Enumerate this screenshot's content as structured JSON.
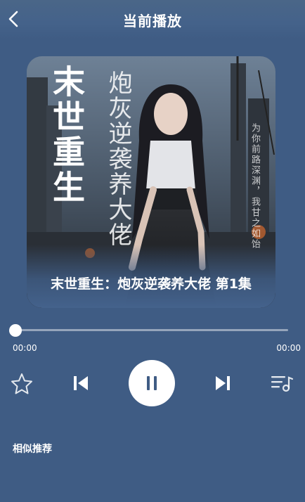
{
  "header": {
    "title": "当前播放"
  },
  "cover": {
    "big_title": "末世重生",
    "subtitle": "炮灰逆袭养大佬",
    "side_text": "为你前路深渊，我甘之如饴",
    "caption": "末世重生：炮灰逆袭养大佬 第1集"
  },
  "player": {
    "current_time": "00:00",
    "total_time": "00:00",
    "progress": 0,
    "state": "playing"
  },
  "sections": {
    "similar_label": "相似推荐"
  },
  "colors": {
    "background": "#3f5c84",
    "accent": "#ffffff"
  }
}
